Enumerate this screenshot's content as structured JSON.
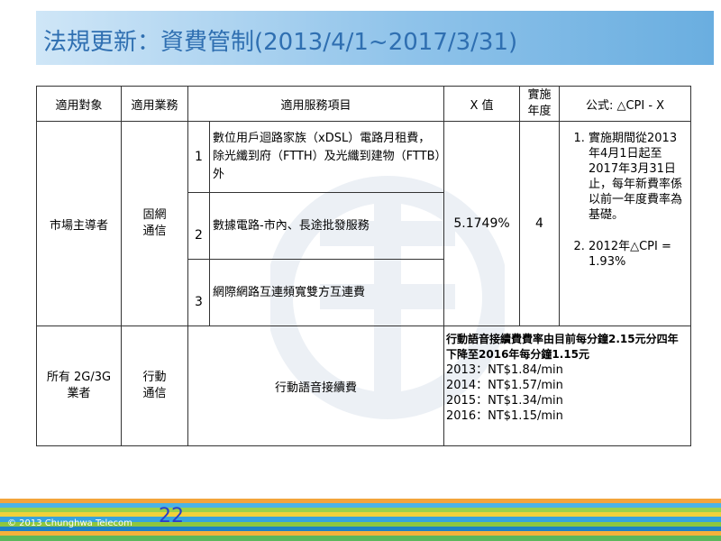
{
  "slide": {
    "title": "法規更新：資費管制(2013/4/1~2017/3/31)",
    "page_number": "22",
    "copyright": "© 2013 Chunghwa Telecom"
  },
  "table": {
    "headers": {
      "target": "適用對象",
      "business": "適用業務",
      "service": "適用服務項目",
      "x_value": "X 值",
      "year": "實施\n年度",
      "formula": "公式: △CPI - X"
    },
    "fixed": {
      "target": "市場主導者",
      "business": "固網\n通信",
      "items": [
        {
          "no": "1",
          "text": "數位用戶迴路家族（xDSL）電路月租費，除光纖到府（FTTH）及光纖到建物（FTTB）外"
        },
        {
          "no": "2",
          "text": "數據電路-市內、長途批發服務"
        },
        {
          "no": "3",
          "text": "網際網路互連頻寬雙方互連費"
        }
      ],
      "x_value": "5.1749%",
      "year": "4",
      "formula_items": [
        "實施期間從2013年4月1日起至2017年3月31日止，每年新費率係以前一年度費率為基礎。",
        "2012年△CPI = 1.93%"
      ]
    },
    "mobile": {
      "target": "所有 2G/3G\n業者",
      "business": "行動\n通信",
      "service": "行動語音接續費",
      "note_lead": "行動語音接續費費率由目前每分鐘2.15元分四年下降至2016年每分鐘1.15元",
      "rates": [
        "2013：NT$1.84/min",
        "2014：NT$1.57/min",
        "2015：NT$1.34/min",
        "2016：NT$1.15/min"
      ]
    }
  },
  "colors": {
    "title_text": "#2f6fb1",
    "title_bar": "#8fc3ea",
    "page_number": "#2a3fc9"
  }
}
